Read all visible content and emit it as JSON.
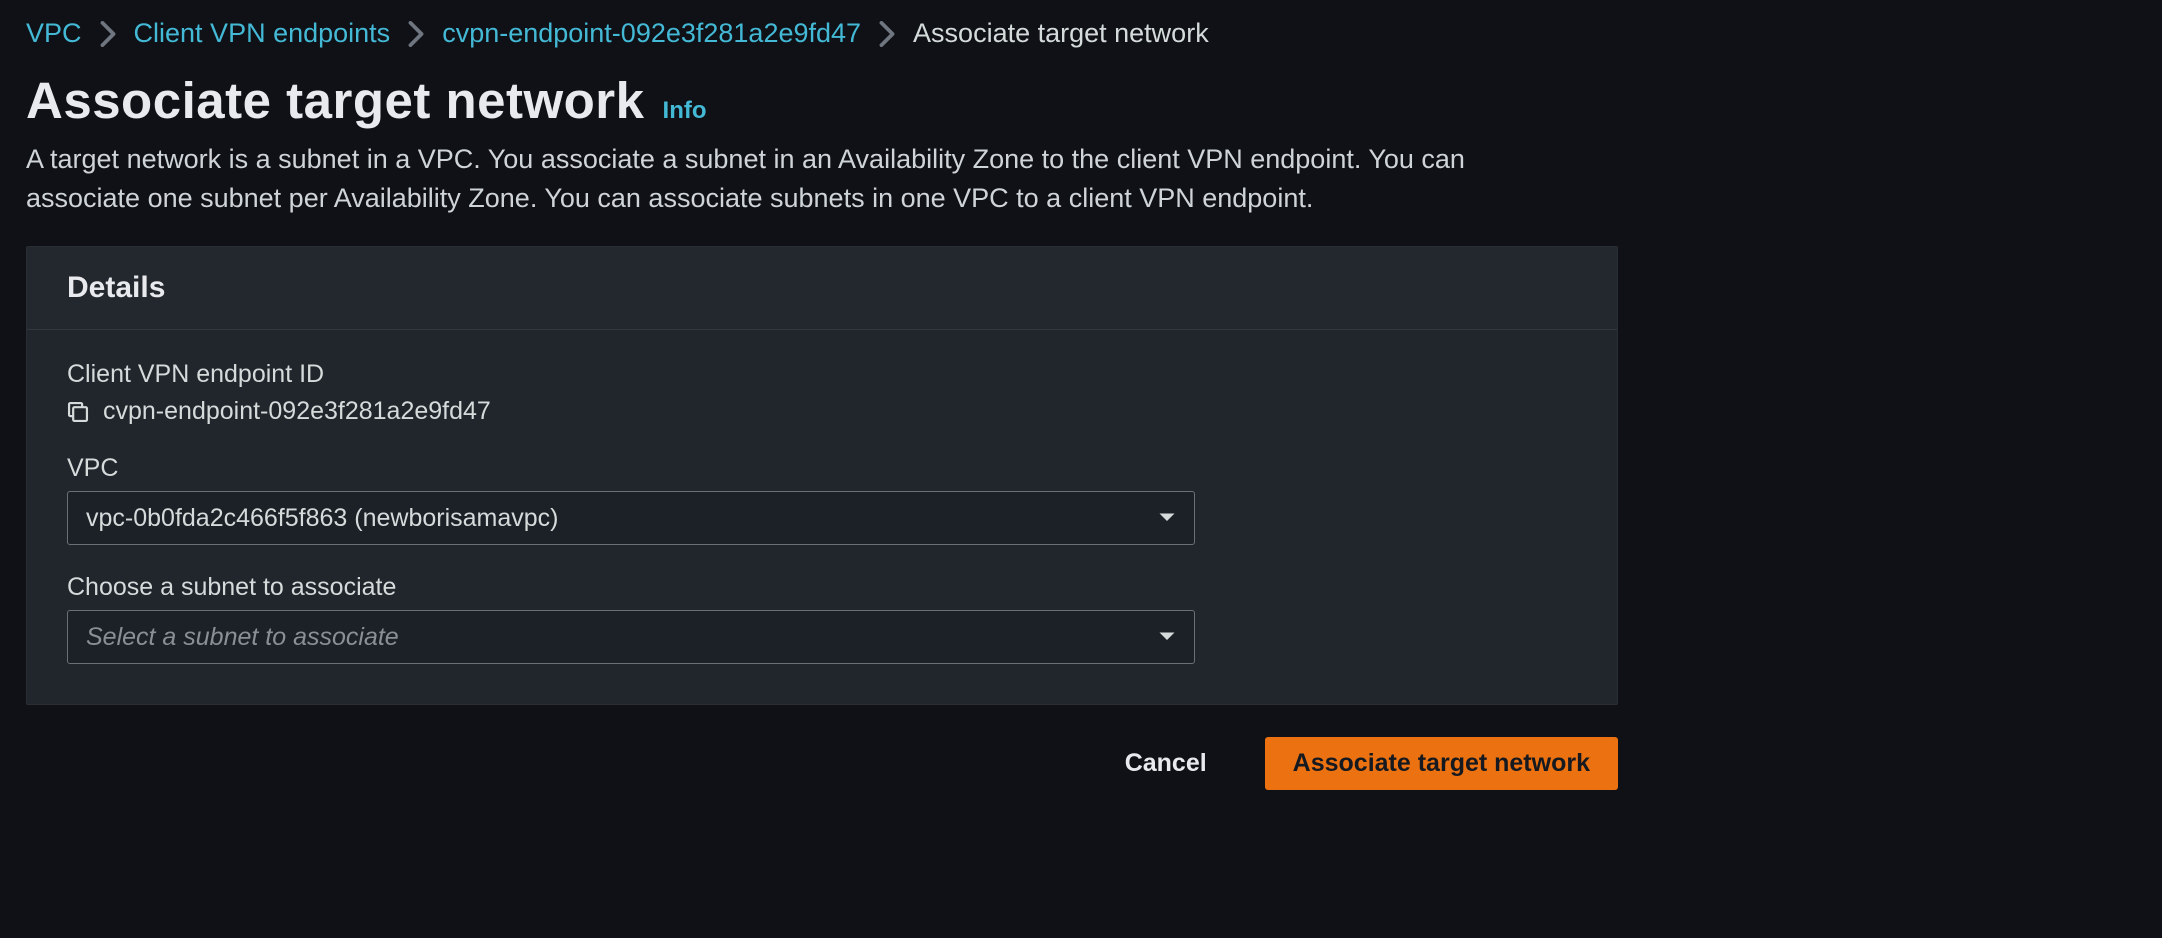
{
  "breadcrumb": {
    "items": [
      {
        "label": "VPC"
      },
      {
        "label": "Client VPN endpoints"
      },
      {
        "label": "cvpn-endpoint-092e3f281a2e9fd47"
      }
    ],
    "current": "Associate target network"
  },
  "page": {
    "title": "Associate target network",
    "info_label": "Info",
    "description": "A target network is a subnet in a VPC. You associate a subnet in an Availability Zone to the client VPN endpoint. You can associate one subnet per Availability Zone. You can associate subnets in one VPC to a client VPN endpoint."
  },
  "panel": {
    "header": "Details",
    "endpoint_label": "Client VPN endpoint ID",
    "endpoint_value": "cvpn-endpoint-092e3f281a2e9fd47",
    "vpc_label": "VPC",
    "vpc_value": "vpc-0b0fda2c466f5f863 (newborisamavpc)",
    "subnet_label": "Choose a subnet to associate",
    "subnet_placeholder": "Select a subnet to associate"
  },
  "actions": {
    "cancel": "Cancel",
    "submit": "Associate target network"
  }
}
